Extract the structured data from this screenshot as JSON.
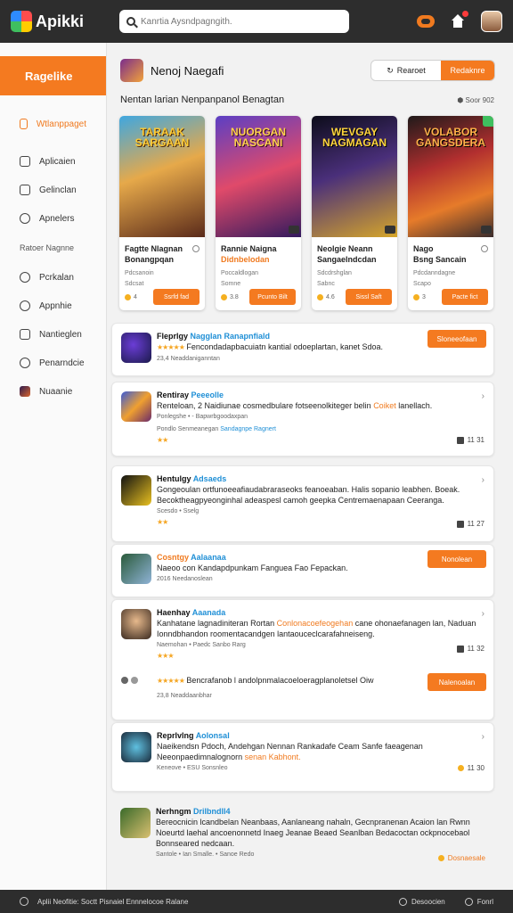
{
  "app": {
    "logo_text": "Apikki"
  },
  "search": {
    "placeholder": "Kanrtia Aysndpagngith."
  },
  "sidebar": {
    "brand": "Ragelike",
    "items": [
      {
        "label": "Wtlanppaget",
        "active": true
      },
      {
        "label": "Aplicaien"
      },
      {
        "label": "Gelinclan"
      },
      {
        "label": "Apnelers"
      }
    ],
    "heading": "Ratoer Nagnne",
    "items2": [
      {
        "label": "Pcrkalan"
      },
      {
        "label": "Appnhie"
      },
      {
        "label": "Nantieglen"
      },
      {
        "label": "Penarndcie"
      },
      {
        "label": "Nuaanie"
      }
    ]
  },
  "header": {
    "title": "Nenoj Naegafi",
    "btn_outline": "Rearoet",
    "btn_primary": "Redaknre"
  },
  "section": {
    "title": "Nentan larian  Nenpanpanol Benagtan",
    "meta": "Soor 902"
  },
  "cards": [
    {
      "art_title": "TARAAK SARGAAN",
      "name": "Fagtte Nlagnan",
      "name2": "Bonangpqan",
      "sub1": "Pdcsanoin",
      "sub2": "Sdcsat",
      "rating": "4",
      "btn": "Ssrfd fad"
    },
    {
      "art_title": "NUORGAN NASCANI",
      "name": "Rannie Naigna",
      "name2": "Didnbelodan",
      "sub1": "Poccaldlogan",
      "sub2": "Somne",
      "rating": "3.8",
      "btn": "Pcunto Bilt"
    },
    {
      "art_title": "WEVGAY NAGMAGAN",
      "name": "Neolgie Neann",
      "name2": "Sangaelndcdan",
      "sub1": "Sdcdrshglan",
      "sub2": "Sabnc",
      "rating": "4.6",
      "btn": "Sissl Saft"
    },
    {
      "art_title": "VOLABOR GANGSDERA",
      "name": "Nago",
      "name2": "Bsng Sancain",
      "sub1": "Pdcdanndagne",
      "sub2": "Scapo",
      "rating": "3",
      "btn": "Pacte fict"
    }
  ],
  "posts": [
    {
      "name": "Fleprlgy",
      "name_hl": "Nagglan Ranapnfiald",
      "text": "Fencondadapbacuiatn kantial odoeplartan, kanet Sdoa.",
      "stars": "★★★★★",
      "meta": "23,4 Neaddaniganntan",
      "btn": "Sloneeofaan"
    },
    {
      "name": "Rentiray",
      "name_hl": "Peeeolle",
      "text": "Renteloan, 2 Naidiunae cosmedbulare fotseenolkiteger belin",
      "text_hl": "Coiket",
      "text_end": "lanellach.",
      "meta1": "Ponlegshe  •  - Bapwrbgoodaxpan",
      "meta2": "Pondlo  Senmeanegan",
      "meta2_hl": "Sandagnpe Ragnert",
      "stars": "★★",
      "count": "11 31"
    },
    {
      "name": "Hentulgy",
      "name_hl": "Adsaeds",
      "text": "Gongeoulan ortfunoeeafiaudabraraseoks feanoeaban. Halis sopanio leabhen. Boeak. Becoktheagpyeonginhal adeaspesl camoh geepka Centremaenapaan Ceeranga.",
      "meta": "Scesdo  •  Sselg",
      "stars": "★★",
      "count": "11 27"
    },
    {
      "name": "Cosntgy",
      "name_hl": "Aalaanaa",
      "text": "Naeoo con  Kandapdpunkam Fanguea Fao Fepackan.",
      "meta": "2016 Needanoslean",
      "btn": "Nonolean"
    },
    {
      "name": "Haenhay",
      "name_hl": "Aaanada",
      "text": "Kanhatane lagnadiniteran  Rortan",
      "text_hl": "Conlonacoefeogehan",
      "text_end": "cane ohonaefanagen lan, Naduan Ionndbhandon roomentacandgen lantaouceclcarafahneiseng.",
      "meta": "Naemohan  •  Paedc Sanbo Rarg",
      "stars": "★★★",
      "count": "11 32"
    },
    {
      "name": "",
      "stars": "★★★★★",
      "text": "Bencrafanob l andolpnmalacoeloeragplanoletsel Oiw",
      "meta": "23,8 Neaddaanbhar",
      "btn": "Nalenoalan"
    },
    {
      "name": "Reprlvlng",
      "name_hl": "Aolonsal",
      "text": "Naeikendsn Pdoch, Andehgan Nennan Rankadafe Ceam Sanfe faeagenan",
      "text2": "Neeonpaedimnalognorn",
      "text2_hl": "senan Kabhont.",
      "meta": "Keneove  •  ESU  Sonsnleo",
      "count": "11 30"
    },
    {
      "name": "Nerhngm",
      "name_hl": "Drilbndll4",
      "text": "Bereocnicin lcandbelan Neanbaas, Aanlaneang nahaln, Gecnpranenan Acaion lan Rwnn Noeurtd laehal ancoenonnetd Inaeg Jeanae Beaed Seanlban Bedacoctan ockpnocebaol Bonnseared nedcaan.",
      "meta": "Santole  •  Ian  Smalle.   • Sanoe Redo",
      "count": "Dosnaesale"
    }
  ],
  "bottombar": {
    "left": "Aplii Neofitie:  Soctt Pisnaiel Ennnelocoe Ralane",
    "right1": "Desoocien",
    "right2": "Fonrl"
  }
}
